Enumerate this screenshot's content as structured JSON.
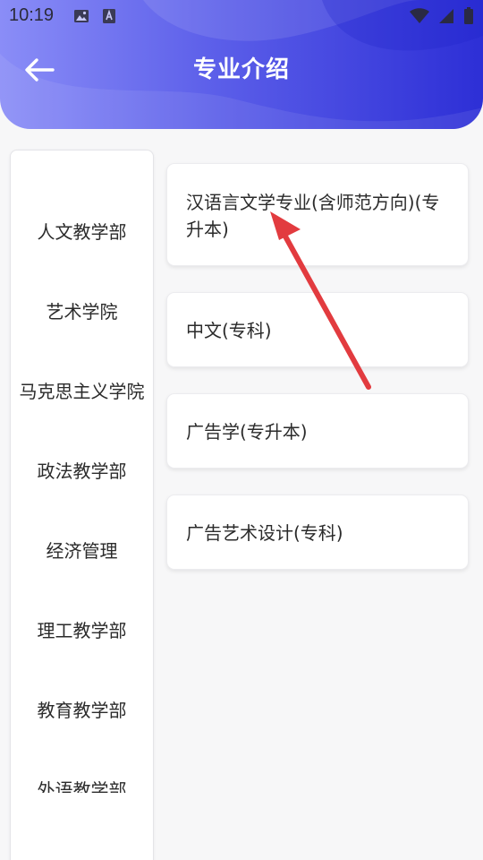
{
  "status_bar": {
    "time": "10:19",
    "left_icons": [
      "image-icon",
      "text-a-icon"
    ],
    "right_icons": [
      "wifi-icon",
      "signal-icon",
      "battery-icon"
    ]
  },
  "header": {
    "title": "专业介绍",
    "back_icon": "back-arrow-icon",
    "gradient_colors": [
      "#8a8df7",
      "#5b5ee9",
      "#2d2fd6"
    ]
  },
  "sidebar": {
    "items": [
      {
        "label": "人文教学部"
      },
      {
        "label": "艺术学院"
      },
      {
        "label": "马克思主义学院"
      },
      {
        "label": "政法教学部"
      },
      {
        "label": "经济管理"
      },
      {
        "label": "理工教学部"
      },
      {
        "label": "教育教学部"
      },
      {
        "label": "外语教学部"
      }
    ]
  },
  "majors": {
    "items": [
      {
        "label": "汉语言文学专业(含师范方向)(专升本)"
      },
      {
        "label": "中文(专科)"
      },
      {
        "label": "广告学(专升本)"
      },
      {
        "label": "广告艺术设计(专科)"
      }
    ]
  },
  "annotation": {
    "arrow_color": "#e23b3f"
  }
}
